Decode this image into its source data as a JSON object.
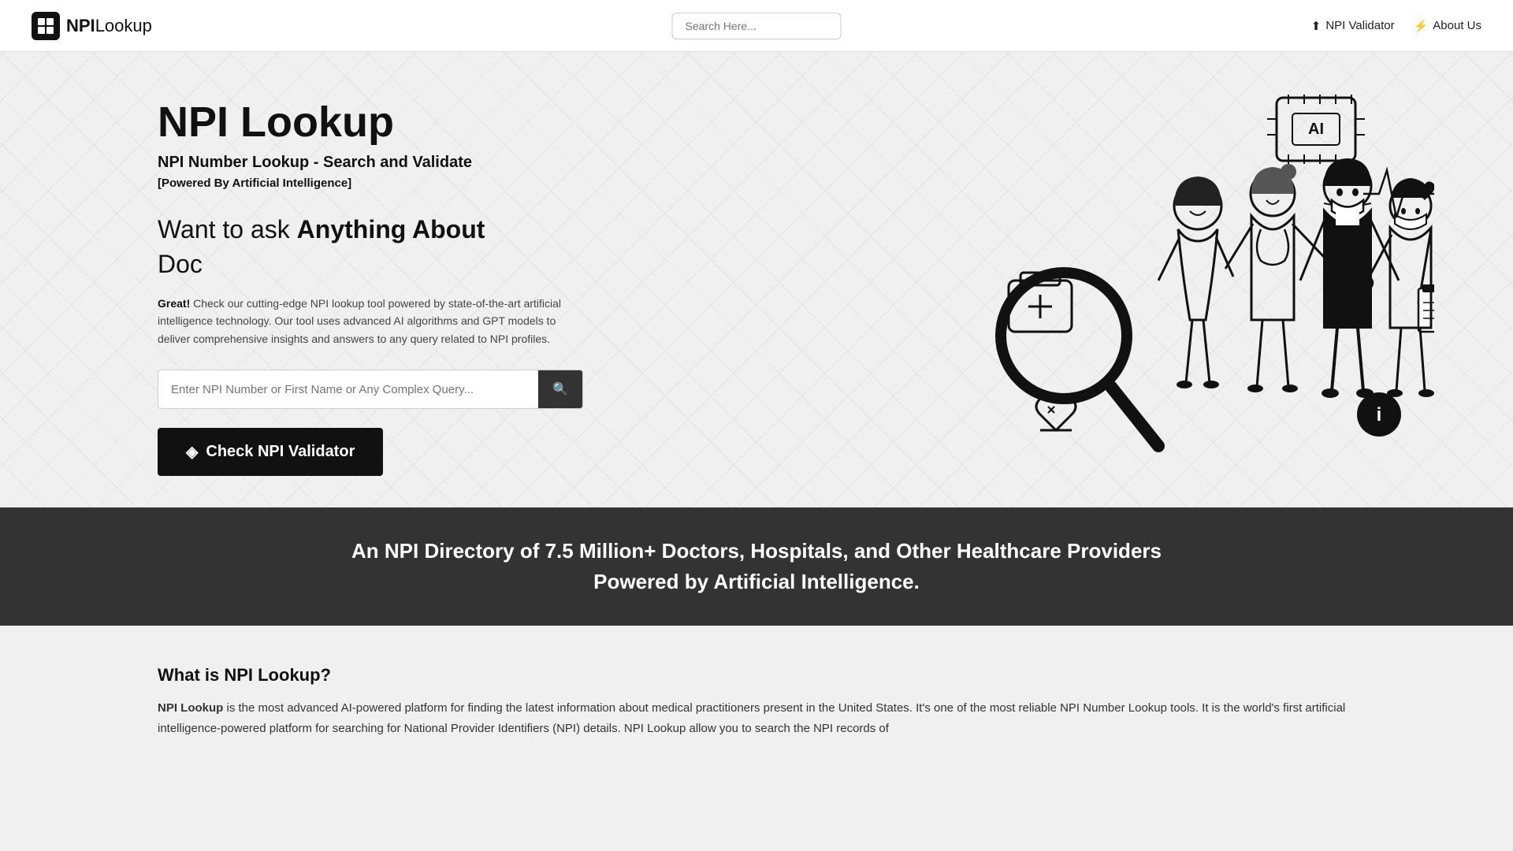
{
  "header": {
    "logo_icon": "⊞",
    "logo_brand": "NPI",
    "logo_name": "Lookup",
    "search_placeholder": "Search Here...",
    "nav": [
      {
        "id": "npi-validator",
        "icon": "⬆",
        "label": "NPI Validator"
      },
      {
        "id": "about-us",
        "icon": "⚡",
        "label": "About Us"
      }
    ]
  },
  "hero": {
    "title": "NPI Lookup",
    "subtitle": "NPI Number Lookup - Search and Validate",
    "powered": "[Powered By Artificial Intelligence]",
    "tagline_part1": "Want to ask ",
    "tagline_bold": "Anything About",
    "tagline_line2": "Doc",
    "description_bold": "Great!",
    "description": " Check our cutting-edge NPI lookup tool powered by state-of-the-art artificial intelligence technology. Our tool uses advanced AI algorithms and GPT models to deliver comprehensive insights and answers to any query related to NPI profiles.",
    "search_placeholder": "Enter NPI Number or First Name or Any Complex Query...",
    "search_button_icon": "🔍",
    "cta_icon": "◈",
    "cta_label": "Check NPI Validator"
  },
  "banner": {
    "line1": "An NPI Directory of 7.5 Million+ Doctors, Hospitals, and Other Healthcare Providers",
    "line2": "Powered by Artificial Intelligence."
  },
  "bottom": {
    "what_is_title": "What is NPI Lookup?",
    "what_is_bold": "NPI Lookup",
    "what_is_text": " is the most advanced AI-powered platform for finding the latest information about medical practitioners present in the United States. It's one of the most reliable NPI Number Lookup tools. It is the world's first artificial intelligence-powered platform for searching for National Provider Identifiers (NPI) details. NPI Lookup allow you to search the NPI records of"
  },
  "colors": {
    "header_bg": "#ffffff",
    "hero_bg": "#f0f0f0",
    "banner_bg": "#333333",
    "cta_bg": "#111111",
    "text_dark": "#111111"
  }
}
